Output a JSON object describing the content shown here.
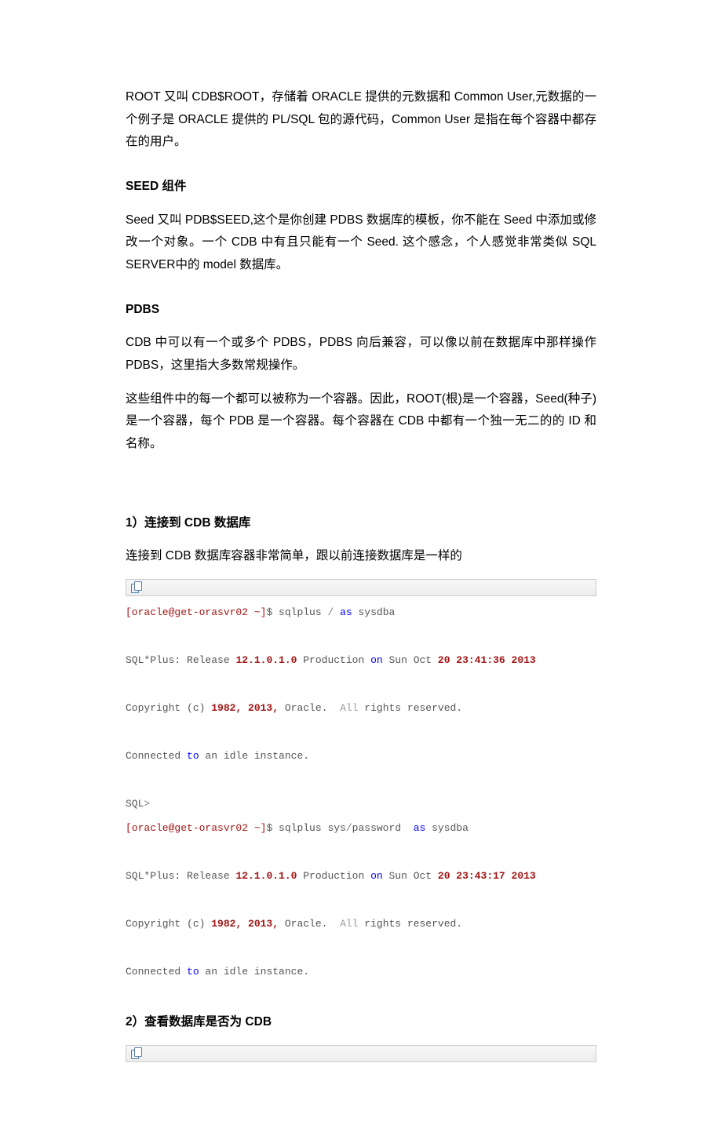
{
  "paragraphs": {
    "root": "ROOT 又叫 CDB$ROOT，存储着 ORACLE 提供的元数据和 Common User,元数据的一个例子是 ORACLE 提供的 PL/SQL 包的源代码，Common User 是指在每个容器中都存在的用户。",
    "seed_title": "SEED 组件",
    "seed": "  Seed 又叫 PDB$SEED,这个是你创建 PDBS 数据库的模板，你不能在 Seed 中添加或修改一个对象。一个 CDB 中有且只能有一个 Seed. 这个感念，个人感觉非常类似 SQL SERVER中的 model 数据库。",
    "pdbs_title": "PDBS",
    "pdbs1": "    CDB 中可以有一个或多个 PDBS，PDBS 向后兼容，可以像以前在数据库中那样操作PDBS，这里指大多数常规操作。",
    "pdbs2": "这些组件中的每一个都可以被称为一个容器。因此，ROOT(根)是一个容器，Seed(种子)是一个容器，每个 PDB 是一个容器。每个容器在 CDB 中都有一个独一无二的的 ID 和名称。",
    "h1": "1）连接到 CDB 数据库",
    "h1_desc": "连接到 CDB 数据库容器非常简单，跟以前连接数据库是一样的",
    "h2": "2）查看数据库是否为 CDB"
  },
  "code1": {
    "prompt1": "[oracle@get-orasvr02 ~]",
    "cmd1a": "$ sqlplus ",
    "cmd1slash": "/",
    "cmd1b": " ",
    "cmd1as": "as",
    "cmd1c": " sysdba",
    "release": "SQL*Plus: Release ",
    "ver1": "12.1.0.1.0",
    "prod1a": " Production ",
    "kw_on": "on",
    "prod1b": " Sun Oct ",
    "ts1": "20 23:41:36 2013",
    "copy_a": "Copyright (c) ",
    "copy_yrs": "1982, 2013,",
    "copy_b": " Oracle. ",
    "kw_all": " All",
    "copy_c": " rights reserved.",
    "conn_a": "Connected ",
    "kw_to": "to",
    "conn_b": " an idle instance.",
    "sqlp": "SQL",
    "sqlgt": ">",
    "prompt2": "[oracle@get-orasvr02 ~]",
    "cmd2a": "$ sqlplus sys",
    "cmd2b": "password  ",
    "cmd2c": " sysdba",
    "ts2": "20 23:43:17 2013"
  }
}
